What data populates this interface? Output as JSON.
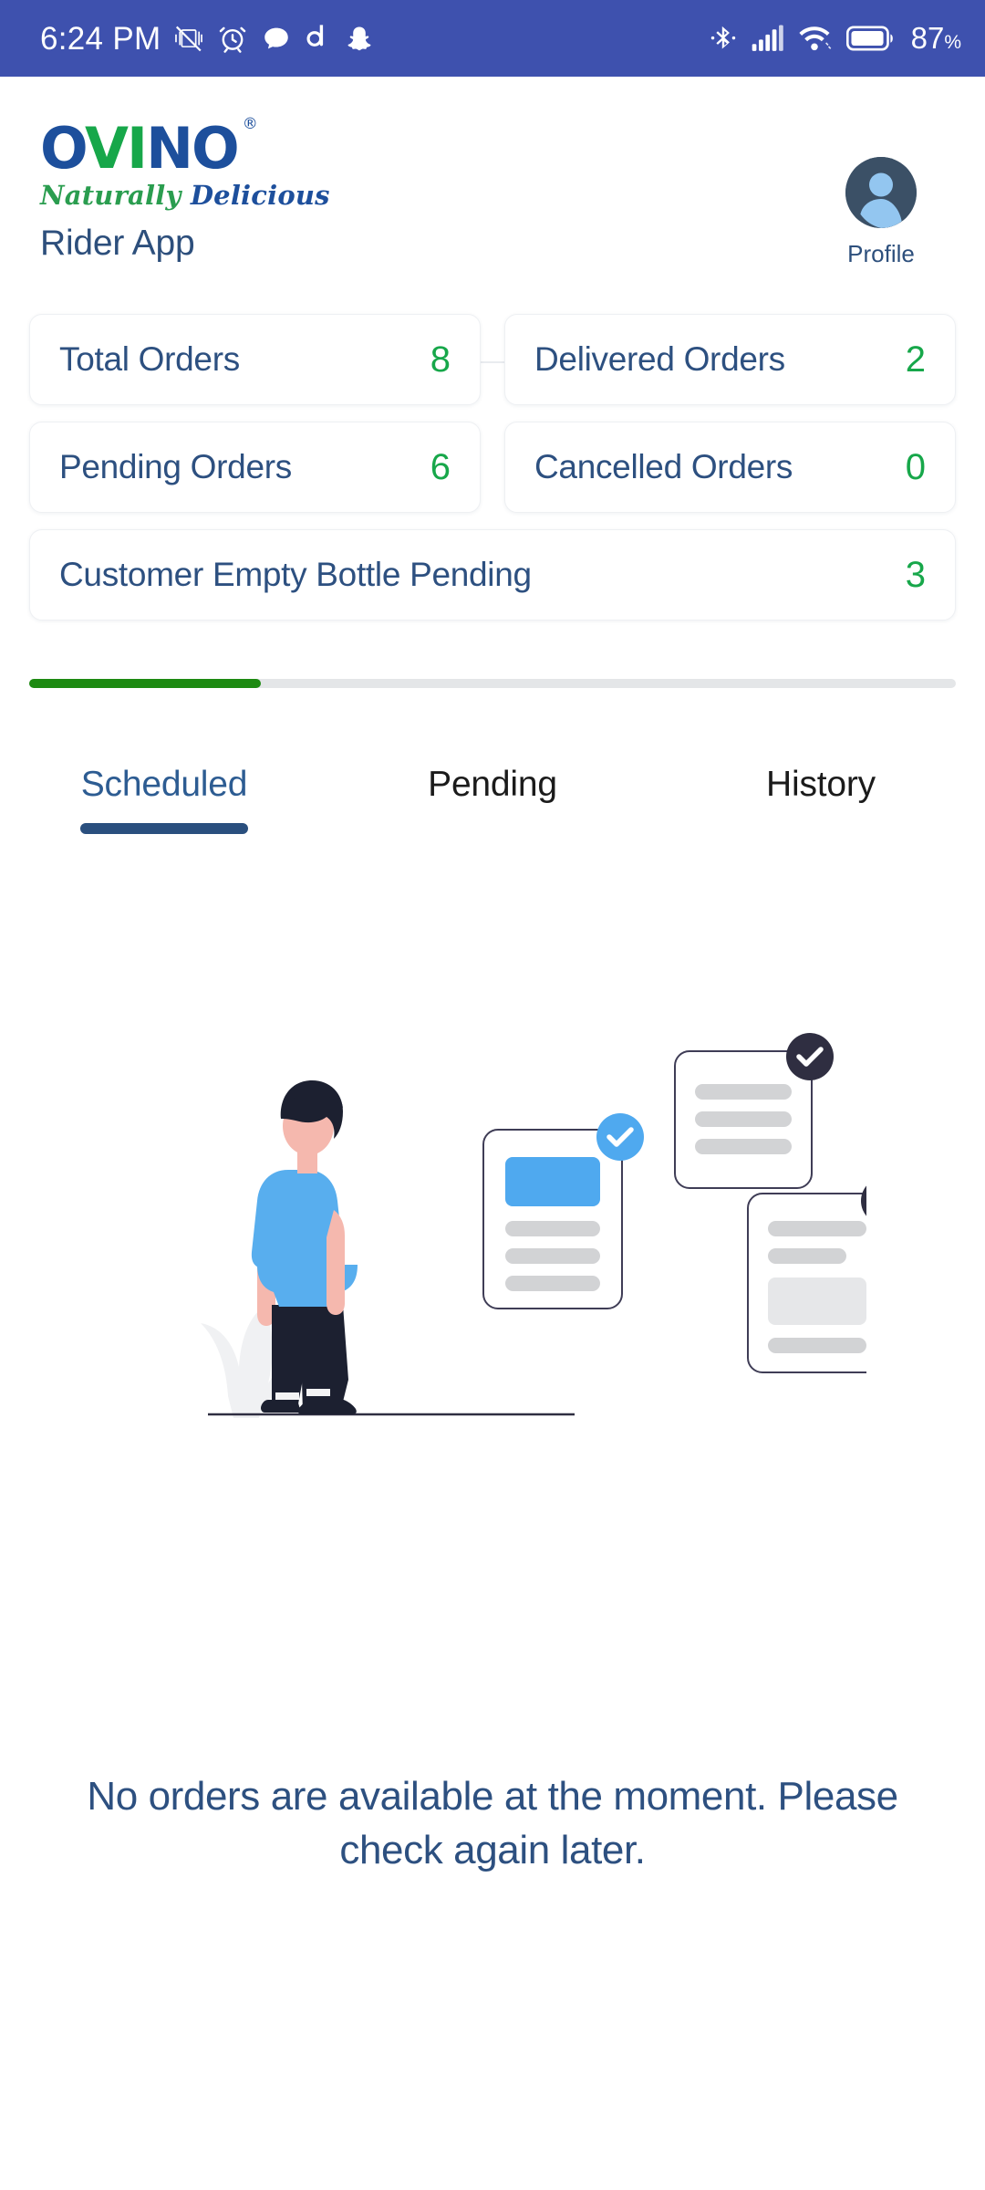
{
  "statusbar": {
    "time": "6:24 PM",
    "battery_percent": "87",
    "percent_sign": "%",
    "left_icons": [
      "vibrate-off-icon",
      "alarm-clock-icon",
      "chat-bubble-icon",
      "app-d-icon",
      "snapchat-ghost-icon"
    ],
    "right_icons": [
      "bluetooth-icon",
      "cellular-signal-icon",
      "wifi-icon",
      "battery-icon"
    ],
    "background_color": "#3e51ae"
  },
  "header": {
    "logo": {
      "word_part1": "O",
      "word_part2": "VI",
      "word_part3": "NO",
      "registered_mark": "®",
      "tagline_green": "Naturally ",
      "tagline_blue": "Delicious"
    },
    "app_title": "Rider App",
    "profile_label": "Profile"
  },
  "stats": {
    "rows": [
      [
        {
          "label": "Total Orders",
          "value": "8"
        },
        {
          "label": "Delivered Orders",
          "value": "2"
        }
      ],
      [
        {
          "label": "Pending Orders",
          "value": "6"
        },
        {
          "label": "Cancelled Orders",
          "value": "0"
        }
      ]
    ],
    "wide_card": {
      "label": "Customer Empty Bottle Pending",
      "value": "3"
    },
    "value_color": "#17a74a",
    "label_color": "#2d5080"
  },
  "progress": {
    "percent": 25,
    "fill_color": "#1d8a12",
    "track_color": "#e4e6e8"
  },
  "tabs": [
    {
      "label": "Scheduled",
      "active": true
    },
    {
      "label": "Pending",
      "active": false
    },
    {
      "label": "History",
      "active": false
    }
  ],
  "illustration": {
    "name": "empty-state-person-with-checked-documents",
    "shirt_color": "#58aeee",
    "pants_color": "#1c2030",
    "hair_color": "#1c2030",
    "skin_color": "#f5b8ae",
    "card_accent_color": "#4fa9ef",
    "check_badge_dark": "#2f2e41",
    "check_badge_light": "#4fa9ef"
  },
  "empty_message": "No orders are available at the moment. Please check again later."
}
